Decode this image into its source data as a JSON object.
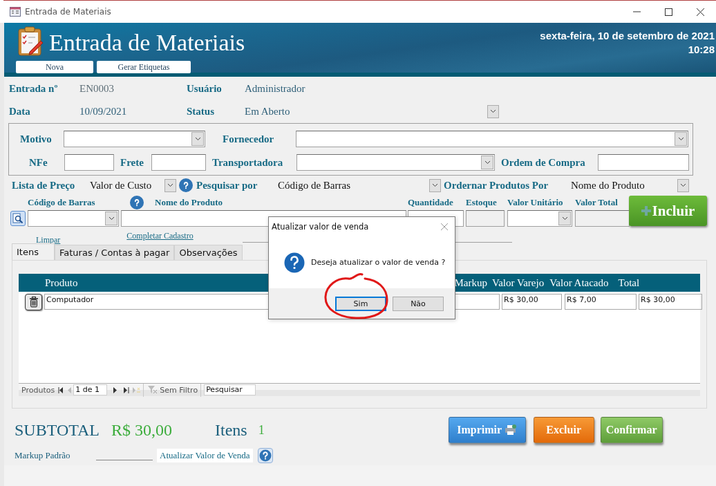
{
  "window": {
    "title": "Entrada de Materiais"
  },
  "header": {
    "title": "Entrada de Materiais",
    "date": "sexta-feira, 10 de setembro de 2021",
    "time": "10:28",
    "buttons": [
      "Nova",
      "Gerar Etiquetas"
    ]
  },
  "info": [
    {
      "label": "Entrada nº",
      "value": "EN0003"
    },
    {
      "label": "Usuário",
      "value": "Administrador"
    },
    {
      "label": "Data",
      "value": "10/09/2021"
    },
    {
      "label": "Status",
      "value": "Em Aberto"
    }
  ],
  "fields": [
    {
      "label": "Motivo",
      "kind": "combo"
    },
    {
      "label": "Fornecedor",
      "kind": "combo"
    },
    {
      "label": "NFe",
      "kind": "text"
    },
    {
      "label": "Frete",
      "kind": "text"
    },
    {
      "label": "Transportadora",
      "kind": "combo"
    },
    {
      "label": "Ordem de Compra",
      "kind": "text"
    }
  ],
  "filters": [
    {
      "label": "Lista de Preço",
      "value": "Valor de Custo"
    },
    {
      "label": "Pesquisar por",
      "value": "Código de Barras"
    },
    {
      "label": "Ordernar Produtos Por",
      "value": "Nome do Produto"
    }
  ],
  "entry": {
    "columns": [
      "Código de Barras",
      "Nome do Produto",
      "Quantidade",
      "Estoque",
      "Valor Unitário",
      "Valor Total"
    ],
    "add_button": "Incluir",
    "links": [
      "Limpar",
      "Completar Cadastro"
    ]
  },
  "tabs": [
    {
      "label": "Itens",
      "selected": true
    },
    {
      "label": "Faturas / Contas à pagar",
      "selected": false
    },
    {
      "label": "Observações",
      "selected": false
    }
  ],
  "table": {
    "columns": [
      "Produto",
      "Markup",
      "Valor Varejo",
      "Valor Atacado",
      "Total"
    ],
    "rows": [
      {
        "produto": "Computador",
        "valor_varejo": "R$ 30,00",
        "valor_atacado": "R$ 7,00",
        "total": "R$ 30,00"
      }
    ]
  },
  "navigator": {
    "label": "Produtos",
    "position": "1 de 1",
    "filter": "Sem Filtro",
    "search": "Pesquisar"
  },
  "summary": {
    "subtotal_label": "SUBTOTAL",
    "subtotal": "R$ 30,00",
    "items_label": "Itens",
    "items": "1"
  },
  "actions": [
    {
      "label": "Imprimir",
      "kind": "print"
    },
    {
      "label": "Excluir",
      "kind": "delete"
    },
    {
      "label": "Confirmar",
      "kind": "confirm"
    }
  ],
  "markup": {
    "label": "Markup Padrão",
    "button": "Atualizar Valor de Venda"
  },
  "dialog": {
    "title": "Atualizar valor de venda",
    "message": "Deseja atualizar o valor de venda ?",
    "buttons": [
      {
        "label": "Sim",
        "selected": true
      },
      {
        "label": "Não",
        "selected": false
      }
    ]
  }
}
